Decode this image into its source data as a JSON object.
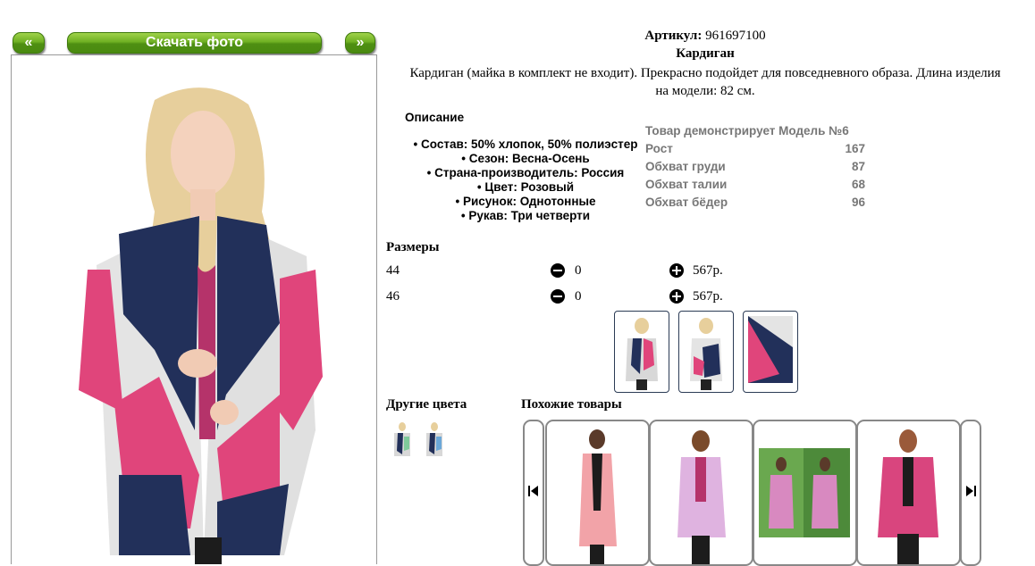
{
  "nav": {
    "prev": "«",
    "download": "Скачать фото",
    "next": "»"
  },
  "product": {
    "article_label": "Артикул:",
    "article_value": "961697100",
    "name": "Кардиган",
    "summary_line1": "Кардиган (майка в комплект не входит). Прекрасно подойдет для повседневного образа. Длина изделия",
    "summary_line2": "на модели: 82 см."
  },
  "description": {
    "heading": "Описание",
    "items": [
      "Состав: 50% хлопок, 50% полиэстер",
      "Сезон: Весна-Осень",
      "Страна-производитель: Россия",
      "Цвет: Розовый",
      "Рисунок: Однотонные",
      "Рукав: Три четверти"
    ]
  },
  "model": {
    "title": "Товар демонстрирует Модель №6",
    "rows": [
      {
        "label": "Рост",
        "value": "167"
      },
      {
        "label": "Обхват груди",
        "value": "87"
      },
      {
        "label": "Обхват талии",
        "value": "68"
      },
      {
        "label": "Обхват бёдер",
        "value": "96"
      }
    ]
  },
  "sizes": {
    "heading": "Размеры",
    "rows": [
      {
        "size": "44",
        "qty": "0",
        "price": "567р."
      },
      {
        "size": "46",
        "qty": "0",
        "price": "567р."
      }
    ]
  },
  "other_colors": {
    "heading": "Другие цвета"
  },
  "similar": {
    "heading": "Похожие товары"
  },
  "colors": {
    "green": "#6fb022",
    "pink": "#e0457b",
    "navy": "#22305a",
    "grey": "#d8d8d8"
  }
}
